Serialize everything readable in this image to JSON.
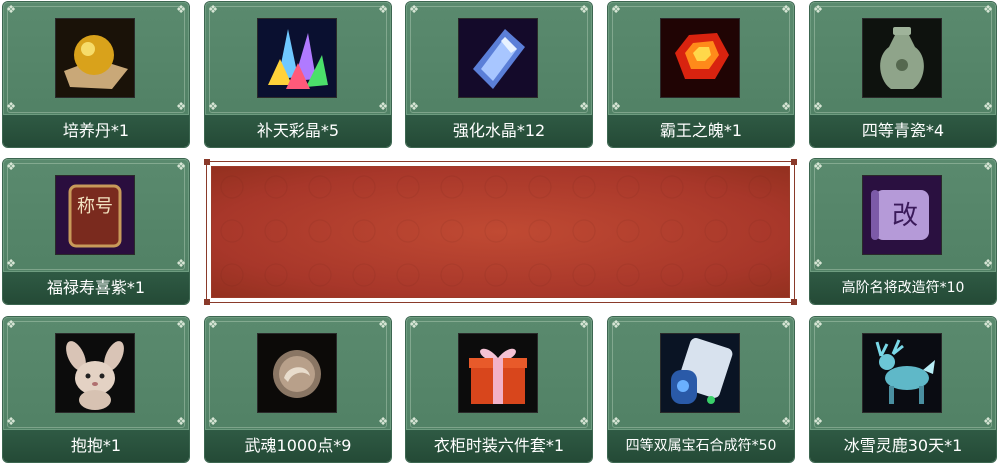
{
  "items": [
    {
      "name": "培养丹*1",
      "icon": "golden-pill-icon"
    },
    {
      "name": "补天彩晶*5",
      "icon": "rainbow-crystals-icon"
    },
    {
      "name": "强化水晶*12",
      "icon": "blue-crystal-icon"
    },
    {
      "name": "霸王之魄*1",
      "icon": "red-gem-icon"
    },
    {
      "name": "四等青瓷*4",
      "icon": "celadon-vase-icon"
    },
    {
      "name": "福禄寿喜紫*1",
      "icon": "title-plaque-icon"
    },
    {
      "name": "高阶名将改造符*10",
      "icon": "purple-scroll-icon"
    },
    {
      "name": "抱抱*1",
      "icon": "bunny-pet-icon"
    },
    {
      "name": "武魂1000点*9",
      "icon": "soul-orb-icon"
    },
    {
      "name": "衣柜时装六件套*1",
      "icon": "gift-box-icon"
    },
    {
      "name": "四等双属宝石合成符*50",
      "icon": "blue-scroll-icon"
    },
    {
      "name": "冰雪灵鹿30天*1",
      "icon": "ice-deer-mount-icon"
    }
  ],
  "icon_glyphs": {
    "plaque": "称号",
    "scroll": "改"
  },
  "colors": {
    "card_bg": "#5a8a6e",
    "label_bg": "#244a36",
    "banner_red": "#b03d2c"
  }
}
